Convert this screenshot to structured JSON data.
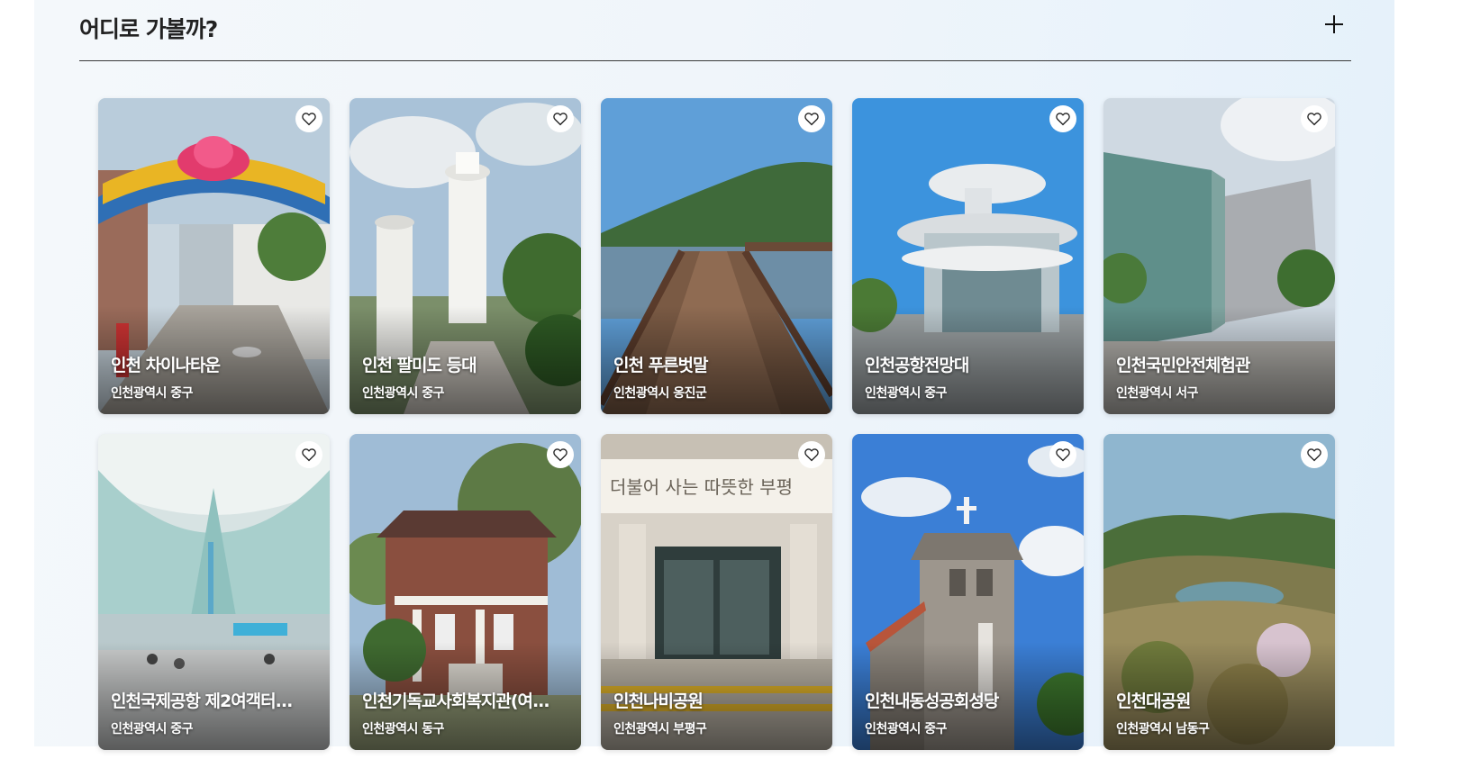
{
  "section": {
    "title": "어디로 가볼까?",
    "expand_icon": "plus-icon"
  },
  "cards": [
    {
      "title": "인천 차이나타운",
      "location": "인천광역시 중구",
      "scene": "chinatown-gate"
    },
    {
      "title": "인천 팔미도 등대",
      "location": "인천광역시 중구",
      "scene": "lighthouse"
    },
    {
      "title": "인천 푸른벗말",
      "location": "인천광역시 옹진군",
      "scene": "boardwalk"
    },
    {
      "title": "인천공항전망대",
      "location": "인천광역시 중구",
      "scene": "observatory"
    },
    {
      "title": "인천국민안전체험관",
      "location": "인천광역시 서구",
      "scene": "glass-building"
    },
    {
      "title": "인천국제공항 제2여객터...",
      "location": "인천광역시 중구",
      "scene": "airport-terminal"
    },
    {
      "title": "인천기독교사회복지관(여...",
      "location": "인천광역시 동구",
      "scene": "brick-house"
    },
    {
      "title": "인천나비공원",
      "location": "인천광역시 부평구",
      "scene": "building-entrance"
    },
    {
      "title": "인천내동성공회성당",
      "location": "인천광역시 중구",
      "scene": "stone-church"
    },
    {
      "title": "인천대공원",
      "location": "인천광역시 남동구",
      "scene": "aerial-park"
    }
  ],
  "entrance_sign": "더불어 사는 따뜻한 부평",
  "fav_icon": "heart-icon",
  "colors": {
    "panel_bg": "#eef4fa",
    "title_text": "#222222",
    "card_text": "#ffffff"
  }
}
